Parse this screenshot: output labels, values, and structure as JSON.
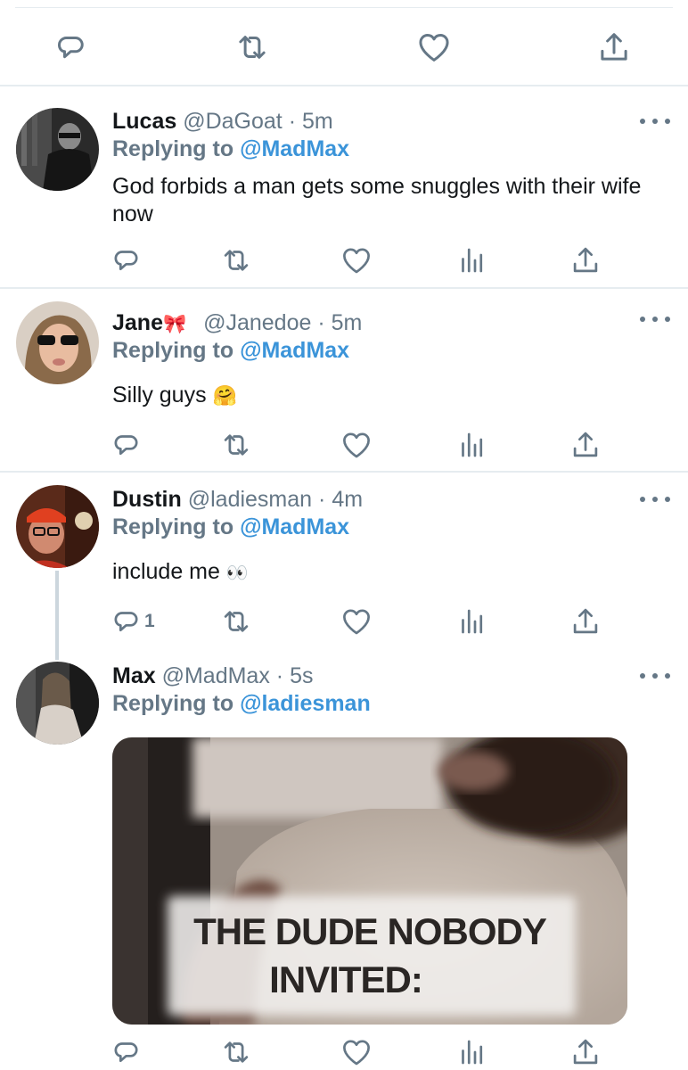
{
  "top_actions": [
    "reply-icon",
    "retweet-icon",
    "like-icon",
    "share-icon"
  ],
  "tweets": [
    {
      "name": "Lucas",
      "handle": "@DaGoat",
      "separator": "·",
      "time": "5m",
      "replying_prefix": "Replying to",
      "replying_to": "@MadMax",
      "text": "God forbids a man gets some snuggles with their wife now",
      "reply_count": ""
    },
    {
      "name": "Jane",
      "name_emoji": "🎀",
      "handle": "@Janedoe",
      "separator": "·",
      "time": "5m",
      "replying_prefix": "Replying to",
      "replying_to": "@MadMax",
      "text": "Silly guys",
      "text_emoji": "🤗",
      "reply_count": ""
    },
    {
      "name": "Dustin",
      "handle": "@ladiesman",
      "separator": "·",
      "time": "4m",
      "replying_prefix": "Replying to",
      "replying_to": "@MadMax",
      "text": "include me",
      "text_emoji": "👀",
      "reply_count": "1"
    },
    {
      "name": "Max",
      "handle": "@MadMax",
      "separator": "·",
      "time": "5s",
      "replying_prefix": "Replying to",
      "replying_to": "@ladiesman",
      "media_caption_line1": "THE DUDE NOBODY",
      "media_caption_line2": "INVITED:",
      "reply_count": ""
    }
  ],
  "colors": {
    "mention": "#3b94d9",
    "secondary": "#657786",
    "divider": "#e6ecf0"
  }
}
